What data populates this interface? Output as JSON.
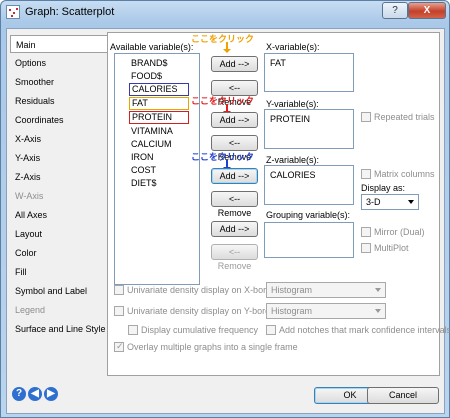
{
  "window": {
    "title": "Graph: Scatterplot",
    "help_label": "?",
    "close_label": "X"
  },
  "tabs": [
    {
      "label": "Main",
      "active": true,
      "enabled": true
    },
    {
      "label": "Options",
      "enabled": true
    },
    {
      "label": "Smoother",
      "enabled": true
    },
    {
      "label": "Residuals",
      "enabled": true
    },
    {
      "label": "Coordinates",
      "enabled": true
    },
    {
      "label": "X-Axis",
      "enabled": true
    },
    {
      "label": "Y-Axis",
      "enabled": true
    },
    {
      "label": "Z-Axis",
      "enabled": true
    },
    {
      "label": "W-Axis",
      "enabled": false
    },
    {
      "label": "All Axes",
      "enabled": true
    },
    {
      "label": "Layout",
      "enabled": true
    },
    {
      "label": "Color",
      "enabled": true
    },
    {
      "label": "Fill",
      "enabled": true
    },
    {
      "label": "Symbol and Label",
      "enabled": true
    },
    {
      "label": "Legend",
      "enabled": false
    },
    {
      "label": "Surface and Line Style",
      "enabled": true
    }
  ],
  "main": {
    "available_label": "Available variable(s):",
    "variables": [
      "BRAND$",
      "FOOD$",
      "CALORIES",
      "FAT",
      "PROTEIN",
      "VITAMINA",
      "CALCIUM",
      "IRON",
      "COST",
      "DIET$"
    ],
    "x_label": "X-variable(s):",
    "x_value": "FAT",
    "y_label": "Y-variable(s):",
    "y_value": "PROTEIN",
    "z_label": "Z-variable(s):",
    "z_value": "CALORIES",
    "grouping_label": "Grouping variable(s):",
    "add_label": "Add -->",
    "remove_label": "<-- Remove",
    "annotation": "ここをクリック",
    "annotation_colors": [
      "#f0a000",
      "#e02020",
      "#2040d0"
    ],
    "repeated_trials": "Repeated trials",
    "matrix_columns": "Matrix columns",
    "display_as_label": "Display as:",
    "display_as_value": "3-D",
    "mirror_dual": "Mirror (Dual)",
    "multiplot": "MultiPlot",
    "univariate_x": "Univariate density display on X-border",
    "univariate_y": "Univariate density display on Y-border",
    "histogram": "Histogram",
    "display_cumulative": "Display cumulative frequency",
    "add_notches": "Add notches that mark confidence intervals",
    "overlay": "Overlay multiple graphs into a single frame"
  },
  "footer": {
    "help_icon": "?",
    "ok_label": "OK",
    "cancel_label": "Cancel"
  }
}
